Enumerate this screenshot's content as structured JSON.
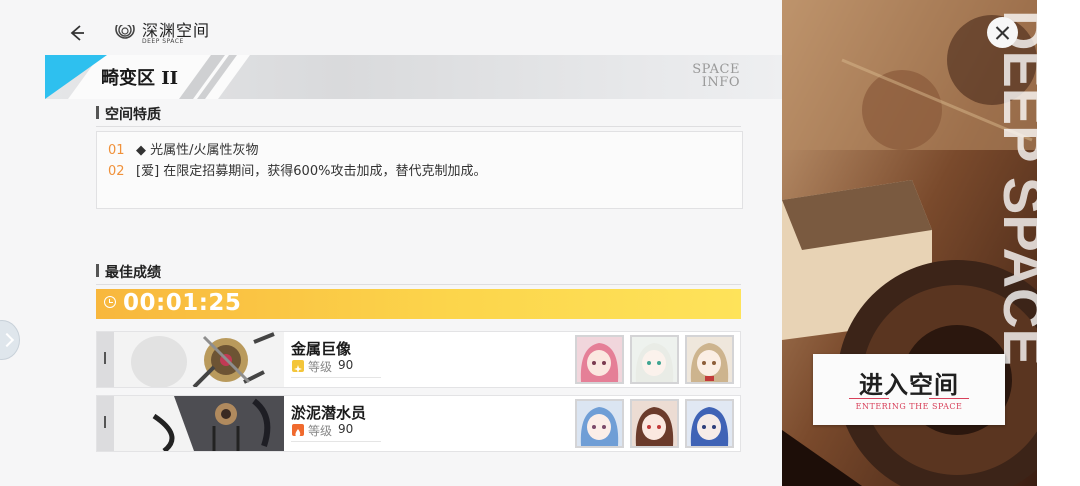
{
  "header": {
    "back_icon": "arrow-left-icon",
    "brand_icon": "spiral-logo-icon",
    "brand_title": "深渊空间",
    "brand_subtitle": "DEEP SPACE"
  },
  "banner": {
    "title": "畸变区 II",
    "info_line1": "SPACE",
    "info_line2": "INFO",
    "accent_color": "#2ec0ef"
  },
  "traits_section": {
    "heading": "空间特质",
    "items": [
      {
        "num": "01",
        "text": "◆ 光属性/火属性灰物"
      },
      {
        "num": "02",
        "text": "[爱] 在限定招募期间，获得600%攻击加成，替代克制加成。"
      }
    ]
  },
  "best_section": {
    "heading": "最佳成绩",
    "clock_icon": "clock-icon",
    "time": "00:01:25"
  },
  "bosses": [
    {
      "name": "金属巨像",
      "level_label": "等级",
      "level": "90",
      "element_icon": "light-element-icon",
      "element_color": "#f3c53a",
      "team": [
        "pink-hair-character",
        "white-hair-character",
        "blonde-hair-character"
      ]
    },
    {
      "name": "淤泥潜水员",
      "level_label": "等级",
      "level": "90",
      "element_icon": "fire-element-icon",
      "element_color": "#f06a2e",
      "team": [
        "blue-hair-character",
        "brown-hair-character",
        "blue-short-hair-character"
      ]
    }
  ],
  "side_panel": {
    "close_icon": "close-icon",
    "vertical_text": "DEEP SPACE",
    "enter_button": {
      "label": "进入空间",
      "sublabel": "ENTERING THE SPACE"
    }
  },
  "side_handle_icon": "chevron-right-icon"
}
